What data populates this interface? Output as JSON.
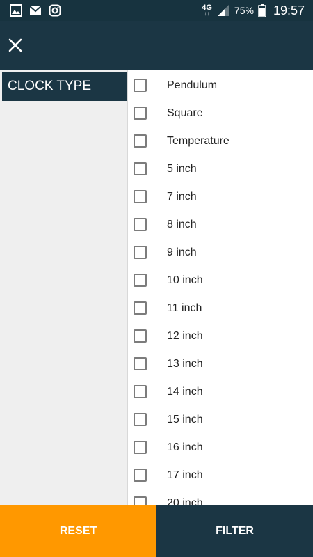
{
  "status_bar": {
    "network": "4G",
    "battery": "75%",
    "time": "19:57",
    "icons": [
      "gallery-icon",
      "gmail-icon",
      "instagram-icon",
      "signal-icon",
      "battery-icon"
    ]
  },
  "toolbar": {
    "close_icon": "close-icon"
  },
  "categories": [
    {
      "label": "CLOCK TYPE",
      "active": true
    }
  ],
  "options": [
    {
      "label": "Pendulum",
      "checked": false
    },
    {
      "label": "Square",
      "checked": false
    },
    {
      "label": "Temperature",
      "checked": false
    },
    {
      "label": "5 inch",
      "checked": false
    },
    {
      "label": "7 inch",
      "checked": false
    },
    {
      "label": "8 inch",
      "checked": false
    },
    {
      "label": "9 inch",
      "checked": false
    },
    {
      "label": "10 inch",
      "checked": false
    },
    {
      "label": "11 inch",
      "checked": false
    },
    {
      "label": "12 inch",
      "checked": false
    },
    {
      "label": "13 inch",
      "checked": false
    },
    {
      "label": "14 inch",
      "checked": false
    },
    {
      "label": "15 inch",
      "checked": false
    },
    {
      "label": "16 inch",
      "checked": false
    },
    {
      "label": "17 inch",
      "checked": false
    },
    {
      "label": "20 inch",
      "checked": false
    }
  ],
  "buttons": {
    "reset": "RESET",
    "filter": "FILTER"
  },
  "colors": {
    "primary": "#1b3644",
    "accent": "#ff9800",
    "sidebar_bg": "#efefef"
  }
}
